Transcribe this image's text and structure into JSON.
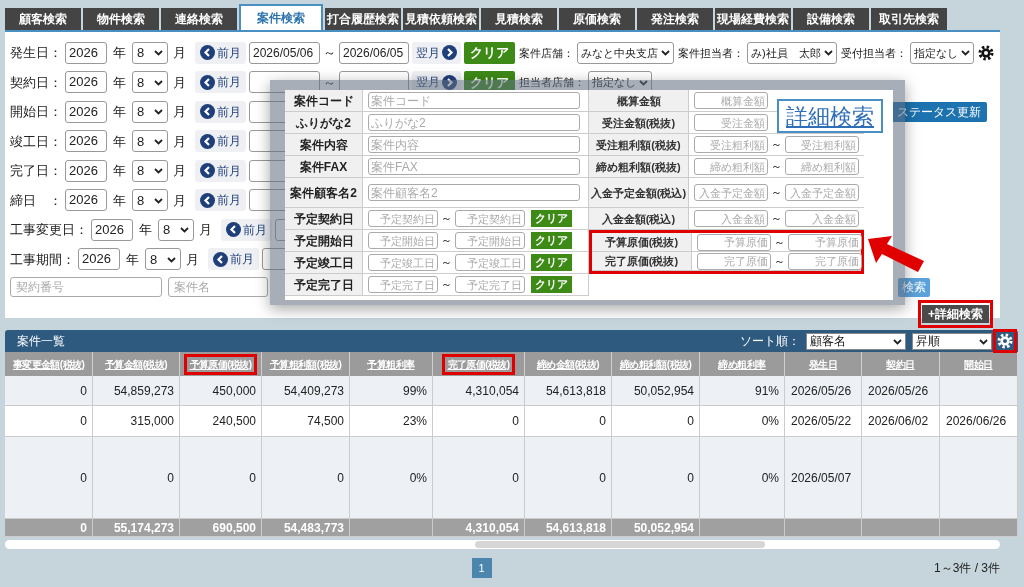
{
  "tabs": [
    {
      "label": "顧客検索",
      "selected": false
    },
    {
      "label": "物件検索",
      "selected": false
    },
    {
      "label": "連絡検索",
      "selected": false
    },
    {
      "label": "案件検索",
      "selected": true
    },
    {
      "label": "打合履歴検索",
      "selected": false
    },
    {
      "label": "見積依頼検索",
      "selected": false
    },
    {
      "label": "見積検索",
      "selected": false
    },
    {
      "label": "原価検索",
      "selected": false
    },
    {
      "label": "発注検索",
      "selected": false
    },
    {
      "label": "現場経費検索",
      "selected": false
    },
    {
      "label": "設備検索",
      "selected": false
    },
    {
      "label": "取引先検索",
      "selected": false
    }
  ],
  "filters": {
    "date_rows": [
      {
        "label": "発生日：",
        "year": "2026",
        "year_unit": "年",
        "month": "8",
        "month_unit": "月",
        "prev": "前月",
        "from": "2026/05/06",
        "tilde": "～",
        "to": "2026/06/05",
        "next": "翌月",
        "clear": "クリア",
        "extras": [
          {
            "label": "案件店舗：",
            "value": "みなと中央支店"
          },
          {
            "label": "案件担当者：",
            "value": "み)社員　太郎"
          },
          {
            "label": "受付担当者：",
            "value": "指定なし"
          }
        ]
      },
      {
        "label": "契約日：",
        "year": "2026",
        "year_unit": "年",
        "month": "8",
        "month_unit": "月",
        "prev": "前月",
        "tilde": "～",
        "next": "翌月",
        "clear": "クリア",
        "extras": [
          {
            "label": "担当者店舗：",
            "value": "指定なし"
          }
        ]
      },
      {
        "label": "開始日：",
        "year": "2026",
        "year_unit": "年",
        "month": "8",
        "month_unit": "月",
        "prev": "前月",
        "side_button": "ステータス更新"
      },
      {
        "label": "竣工日：",
        "year": "2026",
        "year_unit": "年",
        "month": "8",
        "month_unit": "月",
        "prev": "前月"
      },
      {
        "label": "完了日：",
        "year": "2026",
        "year_unit": "年",
        "month": "8",
        "month_unit": "月",
        "prev": "前月"
      },
      {
        "label": "締日　：",
        "year": "2026",
        "year_unit": "年",
        "month": "8",
        "month_unit": "月",
        "prev": "前月"
      },
      {
        "label": "工事変更日：",
        "year": "2026",
        "year_unit": "年",
        "month": "8",
        "month_unit": "月",
        "prev": "前月"
      },
      {
        "label": "工事期間：",
        "year": "2026",
        "year_unit": "年",
        "month": "8",
        "month_unit": "月",
        "prev": "前月"
      }
    ],
    "text_fields": [
      {
        "placeholder": "契約番号"
      },
      {
        "placeholder": "案件名"
      }
    ],
    "search_button": "検索",
    "detail_button": {
      "label": "+詳細検索",
      "highlighted": true
    }
  },
  "detail_panel": {
    "title": "詳細検索",
    "rows": [
      {
        "label": "案件コード",
        "kind": "text",
        "placeholder": "案件コード"
      },
      {
        "label": "ふりがな2",
        "kind": "text",
        "placeholder": "ふりがな2"
      },
      {
        "label": "案件内容",
        "kind": "text",
        "placeholder": "案件内容"
      },
      {
        "label": "案件FAX",
        "kind": "text",
        "placeholder": "案件FAX"
      },
      {
        "label": "案件顧客名2",
        "kind": "text",
        "placeholder": "案件顧客名2"
      },
      {
        "label": "予定契約日",
        "kind": "range",
        "fields": [
          {
            "placeholder": "予定契約日"
          },
          {
            "placeholder": "予定契約日"
          }
        ],
        "tilde": "～",
        "clear": "クリア"
      },
      {
        "label": "予定開始日",
        "kind": "range",
        "fields": [
          {
            "placeholder": "予定開始日"
          },
          {
            "placeholder": "予定開始日"
          }
        ],
        "tilde": "～",
        "clear": "クリア"
      },
      {
        "label": "予定竣工日",
        "kind": "range",
        "fields": [
          {
            "placeholder": "予定竣工日"
          },
          {
            "placeholder": "予定竣工日"
          }
        ],
        "tilde": "～",
        "clear": "クリア"
      },
      {
        "label": "予定完了日",
        "kind": "range",
        "fields": [
          {
            "placeholder": "予定完了日"
          },
          {
            "placeholder": "予定完了日"
          }
        ],
        "tilde": "～",
        "clear": "クリア"
      }
    ],
    "amount_rows": [
      {
        "label": "概算金額",
        "fields": [
          {
            "placeholder": "概算金額"
          }
        ],
        "highlighted": false
      },
      {
        "label": "受注金額(税抜)",
        "fields": [
          {
            "placeholder": "受注金額"
          }
        ],
        "highlighted": false
      },
      {
        "label": "受注粗利額(税抜)",
        "fields": [
          {
            "placeholder": "受注粗利額"
          },
          {
            "placeholder": "受注粗利額"
          }
        ],
        "tilde": "～",
        "highlighted": false
      },
      {
        "label": "締め粗利額(税抜)",
        "fields": [
          {
            "placeholder": "締め粗利額"
          },
          {
            "placeholder": "締め粗利額"
          }
        ],
        "tilde": "～",
        "highlighted": false
      },
      {
        "label": "入金予定金額(税込)",
        "fields": [
          {
            "placeholder": "入金予定金額"
          },
          {
            "placeholder": "入金予定金額"
          }
        ],
        "tilde": "～",
        "highlighted": false
      },
      {
        "label": "入金金額(税込)",
        "fields": [
          {
            "placeholder": "入金金額"
          },
          {
            "placeholder": "入金金額"
          }
        ],
        "tilde": "～",
        "highlighted": false
      },
      {
        "label": "予算原価(税抜)",
        "fields": [
          {
            "placeholder": "予算原価"
          },
          {
            "placeholder": "予算原価"
          }
        ],
        "tilde": "～",
        "highlighted": true
      },
      {
        "label": "完了原価(税抜)",
        "fields": [
          {
            "placeholder": "完了原価"
          },
          {
            "placeholder": "完了原価"
          }
        ],
        "tilde": "～",
        "highlighted": true
      }
    ]
  },
  "list": {
    "title": "案件一覧",
    "sort_label": "ソート順：",
    "sort_field": "顧客名",
    "sort_order": "昇順",
    "settings_highlighted": true,
    "columns": [
      {
        "label": "事変更金額(税抜)",
        "highlighted": false
      },
      {
        "label": "予算金額(税抜)",
        "highlighted": false
      },
      {
        "label": "予算原価(税抜)",
        "highlighted": true
      },
      {
        "label": "予算粗利額(税抜)",
        "highlighted": false
      },
      {
        "label": "予算粗利率",
        "highlighted": false
      },
      {
        "label": "完了原価(税抜)",
        "highlighted": true
      },
      {
        "label": "締め金額(税抜)",
        "highlighted": false
      },
      {
        "label": "締め粗利額(税抜)",
        "highlighted": false
      },
      {
        "label": "締め粗利率",
        "highlighted": false
      },
      {
        "label": "発生日",
        "highlighted": false
      },
      {
        "label": "契約日",
        "highlighted": false
      },
      {
        "label": "開始日",
        "highlighted": false
      }
    ],
    "rows": [
      [
        "0",
        "54,859,273",
        "450,000",
        "54,409,273",
        "99%",
        "4,310,054",
        "54,613,818",
        "50,052,954",
        "91%",
        "2026/05/26",
        "2026/05/26"
      ],
      [
        "0",
        "315,000",
        "240,500",
        "74,500",
        "23%",
        "0",
        "0",
        "0",
        "0%",
        "2026/05/22",
        "2026/06/02",
        "2026/06/26"
      ],
      [
        "0",
        "0",
        "0",
        "0",
        "0%",
        "0",
        "0",
        "0",
        "0%",
        "2026/05/07"
      ]
    ],
    "totals": [
      [
        "0",
        "55,174,273",
        "690,500",
        "54,483,773"
      ],
      [
        "4,310,054",
        "54,613,818",
        "50,052,954"
      ]
    ]
  },
  "pagination": {
    "pages": [
      {
        "label": "1",
        "selected": true
      }
    ],
    "count": "1～3件 / 3件"
  }
}
